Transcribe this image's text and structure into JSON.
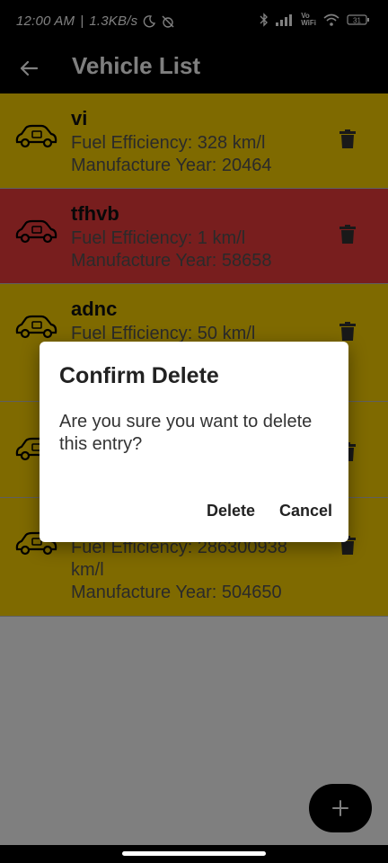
{
  "status": {
    "time": "12:00 AM",
    "speed": "1.3KB/s",
    "volte": "Vo\nWiFi",
    "battery": "31"
  },
  "app_bar": {
    "title": "Vehicle List"
  },
  "vehicles": [
    {
      "name": "vi",
      "fuel": "Fuel Efficiency: 328 km/l",
      "year": "Manufacture Year: 20464",
      "color": "#FFD400"
    },
    {
      "name": "tfhvb",
      "fuel": "Fuel Efficiency: 1 km/l",
      "year": "Manufacture Year: 58658",
      "color": "#F03C3C"
    },
    {
      "name": "adnc",
      "fuel": "Fuel Efficiency: 50 km/l",
      "year": "",
      "color": "#FFD400"
    },
    {
      "name": "",
      "fuel": "",
      "year": "",
      "color": "#FFD400"
    },
    {
      "name": "",
      "fuel": "Fuel Efficiency: 286300938 km/l",
      "year": "Manufacture Year: 504650",
      "color": "#FFD400"
    }
  ],
  "dialog": {
    "title": "Confirm Delete",
    "message": "Are you sure you want to delete this entry?",
    "confirm_label": "Delete",
    "cancel_label": "Cancel"
  },
  "fab": {
    "icon": "plus-icon"
  },
  "icons": {
    "vehicle": "car-icon",
    "delete": "trash-icon",
    "back": "arrow-back-icon"
  }
}
